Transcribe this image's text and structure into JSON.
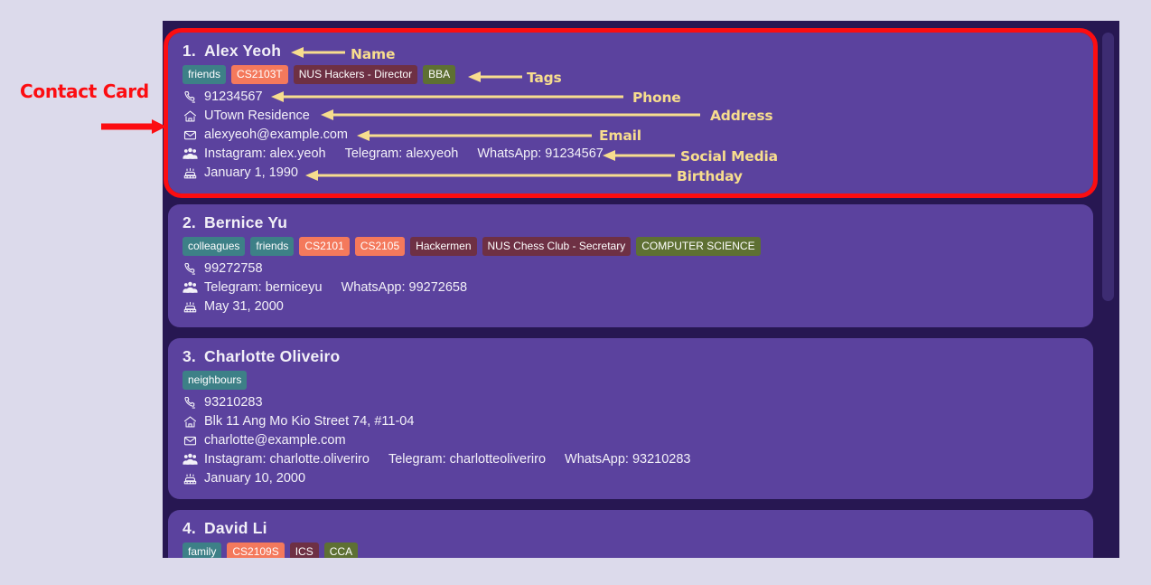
{
  "annotations": {
    "contact_card": "Contact Card",
    "name": "Name",
    "tags": "Tags",
    "phone": "Phone",
    "address": "Address",
    "email": "Email",
    "social_media": "Social Media",
    "birthday": "Birthday",
    "arrow_color_red": "#fc0d11",
    "arrow_color_yellow": "#f7dd8e"
  },
  "theme": {
    "page_background": "#dcdaeb",
    "container_background": "#271752",
    "card_background": "#5b429e",
    "card_text": "#f3f1f8",
    "scrollbar_thumb": "#3d2c72",
    "tag_teal": "#3d8087",
    "tag_salmon": "#f4795c",
    "tag_maroon": "#6e3044",
    "tag_olive": "#5e7033"
  },
  "icons": {
    "phone": "phone-icon",
    "address": "home-icon",
    "email": "envelope-icon",
    "social": "people-group-icon",
    "birthday": "birthday-cake-icon"
  },
  "contacts": [
    {
      "index": "1.",
      "name": "Alex Yeoh",
      "tags": [
        {
          "label": "friends",
          "color": "teal"
        },
        {
          "label": "CS2103T",
          "color": "salmon"
        },
        {
          "label": "NUS Hackers - Director",
          "color": "maroon"
        },
        {
          "label": "BBA",
          "color": "olive"
        }
      ],
      "phone": "91234567",
      "address": "UTown Residence",
      "email": "alexyeoh@example.com",
      "social": [
        "Instagram: alex.yeoh",
        "Telegram: alexyeoh",
        "WhatsApp: 91234567"
      ],
      "birthday": "January 1, 1990"
    },
    {
      "index": "2.",
      "name": "Bernice Yu",
      "tags": [
        {
          "label": "colleagues",
          "color": "teal"
        },
        {
          "label": "friends",
          "color": "teal"
        },
        {
          "label": "CS2101",
          "color": "salmon"
        },
        {
          "label": "CS2105",
          "color": "salmon"
        },
        {
          "label": "Hackermen",
          "color": "maroon"
        },
        {
          "label": "NUS Chess Club - Secretary",
          "color": "maroon"
        },
        {
          "label": "COMPUTER SCIENCE",
          "color": "olive"
        }
      ],
      "phone": "99272758",
      "address": null,
      "email": null,
      "social": [
        "Telegram: berniceyu",
        "WhatsApp: 99272658"
      ],
      "birthday": "May 31, 2000"
    },
    {
      "index": "3.",
      "name": "Charlotte Oliveiro",
      "tags": [
        {
          "label": "neighbours",
          "color": "teal"
        }
      ],
      "phone": "93210283",
      "address": "Blk 11 Ang Mo Kio Street 74, #11-04",
      "email": "charlotte@example.com",
      "social": [
        "Instagram: charlotte.oliveriro",
        "Telegram: charlotteoliveriro",
        "WhatsApp: 93210283"
      ],
      "birthday": "January 10, 2000"
    },
    {
      "index": "4.",
      "name": "David Li",
      "tags": [
        {
          "label": "family",
          "color": "teal"
        },
        {
          "label": "CS2109S",
          "color": "salmon"
        },
        {
          "label": "ICS",
          "color": "maroon"
        },
        {
          "label": "CCA",
          "color": "olive"
        }
      ],
      "phone": null,
      "address": null,
      "email": null,
      "social": [],
      "birthday": null
    }
  ]
}
